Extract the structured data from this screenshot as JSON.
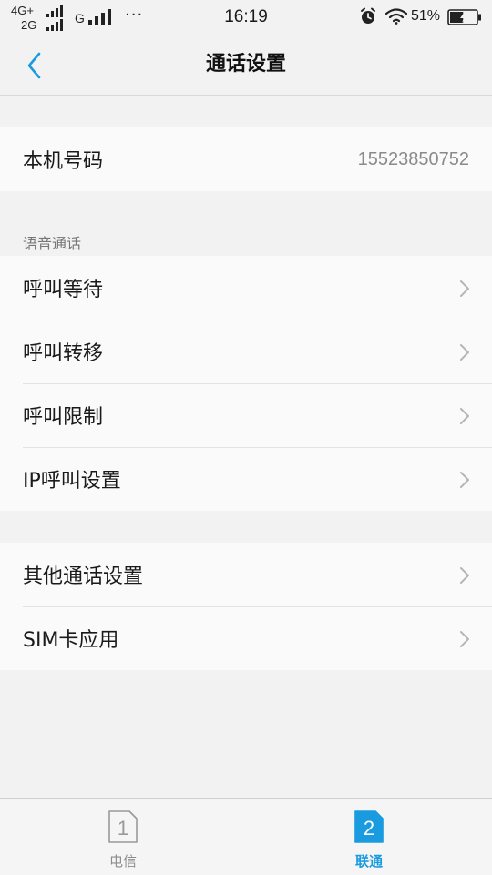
{
  "status_bar": {
    "network_top": "4G+",
    "network_bottom": "2G",
    "network_g": "G",
    "dots": "···",
    "time": "16:19",
    "battery_percent": "51%",
    "battery_level": 0.51,
    "icons": [
      "signal-icon",
      "alarm-icon",
      "wifi-icon",
      "battery-charging-icon"
    ]
  },
  "header": {
    "title": "通话设置",
    "back_icon": "back-arrow-icon",
    "accent_color": "#1a9be0"
  },
  "phone_number": {
    "label": "本机号码",
    "value": "15523850752"
  },
  "voice_call": {
    "section_title": "语音通话",
    "items": [
      {
        "label": "呼叫等待"
      },
      {
        "label": "呼叫转移"
      },
      {
        "label": "呼叫限制"
      },
      {
        "label": "IP呼叫设置"
      }
    ]
  },
  "other": {
    "items": [
      {
        "label": "其他通话设置"
      },
      {
        "label": "SIM卡应用"
      }
    ]
  },
  "sim_bar": {
    "sim1": {
      "number": "1",
      "label": "电信",
      "active": false
    },
    "sim2": {
      "number": "2",
      "label": "联通",
      "active": true
    },
    "active_color": "#1a9be0"
  }
}
